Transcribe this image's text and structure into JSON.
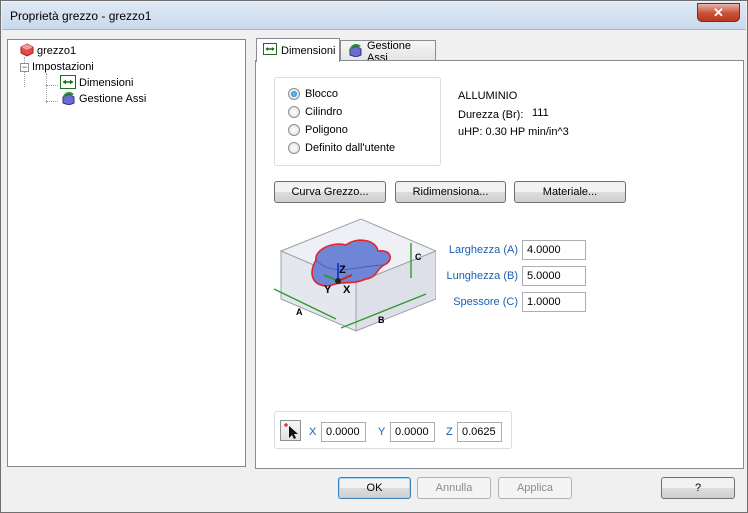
{
  "window": {
    "title": "Proprietà grezzo - grezzo1",
    "close_label": "✕"
  },
  "tree": {
    "root": "grezzo1",
    "group": "Impostazioni",
    "items": [
      "Dimensioni",
      "Gestione Assi"
    ]
  },
  "tabs": [
    {
      "label": "Dimensioni"
    },
    {
      "label": "Gestione Assi"
    }
  ],
  "shape": {
    "options": [
      "Blocco",
      "Cilindro",
      "Poligono",
      "Definito dall'utente"
    ],
    "selected": "Blocco"
  },
  "material": {
    "name": "ALLUMINIO",
    "hardness_label": "Durezza (Br):",
    "hardness_value": "111",
    "uhp": "uHP: 0.30 HP min/in^3"
  },
  "buttons": {
    "curve": "Curva Grezzo...",
    "resize": "Ridimensiona...",
    "material": "Materiale..."
  },
  "dimensions": {
    "width_label": "Larghezza (A)",
    "width_value": "4.0000",
    "length_label": "Lunghezza (B)",
    "length_value": "5.0000",
    "thickness_label": "Spessore (C)",
    "thickness_value": "1.0000"
  },
  "diagram_labels": {
    "a": "A",
    "b": "B",
    "c": "C",
    "x": "X",
    "y": "Y",
    "z": "Z"
  },
  "origin": {
    "x_label": "X",
    "x_value": "0.0000",
    "y_label": "Y",
    "y_value": "0.0000",
    "z_label": "Z",
    "z_value": "0.0625"
  },
  "footer": {
    "ok": "OK",
    "cancel": "Annulla",
    "apply": "Applica",
    "help": "?"
  },
  "colors": {
    "accent_label": "#1a5fb4",
    "part_fill": "#6f86d6",
    "part_outline": "#e0262b"
  }
}
